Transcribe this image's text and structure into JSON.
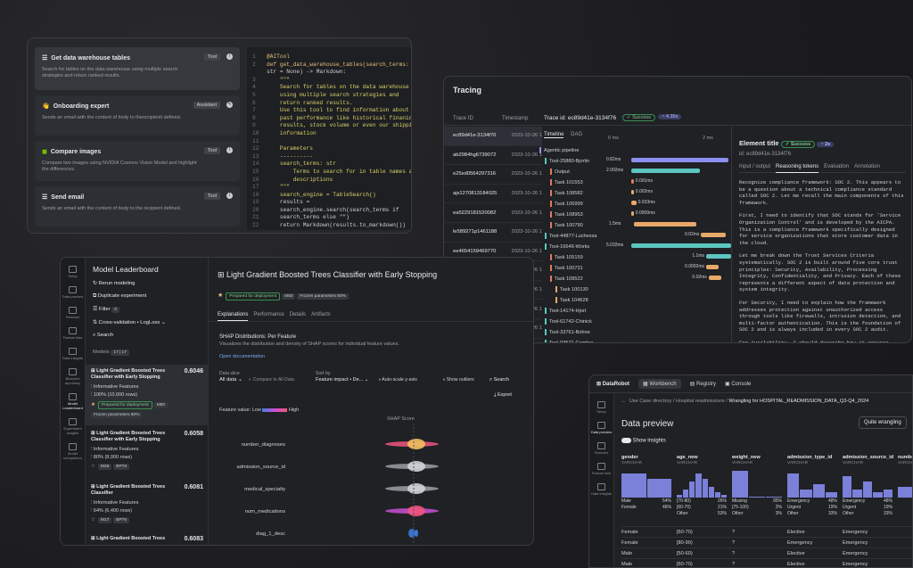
{
  "tools": {
    "items": [
      {
        "title": "Get data warehouse tables",
        "tag": "Tool",
        "desc": "Search for tables on the data warehouse using multiple search strategies and return ranked results."
      },
      {
        "title": "Onboarding expert",
        "tag": "Assistant",
        "desc": "Sends an email with the content of body to therecipientt defined."
      },
      {
        "title": "Compare images",
        "tag": "Tool",
        "desc": "Compare two images using NVIDIA Cosmos Vision Model and highlight the differences."
      },
      {
        "title": "Send email",
        "tag": "Tool",
        "desc": "Sends an email with the content of body to the recipient defined."
      }
    ],
    "code": [
      "@AITool",
      "def get_data_warehouse_tables(search_terms:",
      "str = None) -> Markdown:",
      "    \"\"\"",
      "    Search for tables on the data warehouse",
      "    using multiple search strategies and",
      "    return ranked results.",
      "    Use this tool to find information about",
      "    past performance like historical finanical",
      "    results, stock volume or even our shipping",
      "    information",
      "",
      "    Parameters",
      "    ----------",
      "    search_terms: str",
      "        Terms to search for in table names and",
      "        descriptions",
      "    \"\"\"",
      "    search_engine = TableSearch()",
      "    results =",
      "    search_engine.search(search_terms if",
      "    search_terms else \"\")",
      "    return Markdown(results.to_markdown())"
    ],
    "line_numbers": [
      "1",
      "2",
      "",
      "3",
      "4",
      "5",
      "6",
      "7",
      "8",
      "9",
      "10",
      "11",
      "12",
      "13",
      "14",
      "15",
      "16",
      "17",
      "18",
      "19",
      "20",
      "21",
      "22"
    ]
  },
  "tracing": {
    "title": "Tracing",
    "col_trace_id": "Trace ID",
    "col_timestamp": "Timestamp",
    "trace_header": "Trace id: ec89d41e-3134f76",
    "status": "Success",
    "duration": "4.35s",
    "tab_timeline": "Timeline",
    "tab_dag": "DAG",
    "time_0": "0 ms",
    "time_2": "2 ms",
    "rows": [
      {
        "id": "ec89d41e-3134f76",
        "ts": "2023-10-26 1"
      },
      {
        "id": "ab2984hg6739072",
        "ts": "2023-10-26 1"
      },
      {
        "id": "e25sd0564297316",
        "ts": "2023-10-26 1"
      },
      {
        "id": "ajs1270813184025",
        "ts": "2023-10-26 1"
      },
      {
        "id": "ea5229181520082",
        "ts": "2023-10-26 1"
      },
      {
        "id": "le589271p1461188",
        "ts": "2023-10-26 1"
      },
      {
        "id": "ee4654159469770",
        "ts": "2023-10-26 1"
      },
      {
        "id": "sd4626583971098",
        "ts": "2023-10-26 1"
      },
      {
        "id": "sa6902076008730",
        "ts": "2023-10-26 1"
      },
      {
        "id": "kd1065203071322",
        "ts": "2023-10-26 1"
      },
      {
        "id": "sd4626583971098",
        "ts": "2023-10-26 1"
      }
    ],
    "tree": [
      "Agentic pipeline",
      "Tool-25880-Bjorlin",
      "Output",
      "Task 101553",
      "Task 108582",
      "Task 106999",
      "Task 108953",
      "Task 100790",
      "Tool-44877-Luchessa",
      "Tool-16646-Works",
      "Task 105159",
      "Task 100731",
      "Task 108522",
      "Task 100130",
      "Task 104628",
      "Tool-14174-Hjort",
      "Tool-61742-Chinick",
      "Tool-33761-Bohne",
      "Tool-93571-Cambre"
    ],
    "bars": [
      {
        "label": "0.82ms",
        "start": 0.2,
        "width": 0.78,
        "color": "#8c8ff0"
      },
      {
        "label": "2.002ms",
        "start": 0.2,
        "width": 0.55,
        "color": "#5cc5c0"
      },
      {
        "label": "0.001ms",
        "start": 0.2,
        "width": 0.02,
        "color": "#e07a5a"
      },
      {
        "label": "0.002ms",
        "start": 0.2,
        "width": 0.02,
        "color": "#e8a86a"
      },
      {
        "label": "0.033ms",
        "start": 0.2,
        "width": 0.04,
        "color": "#e8a86a"
      },
      {
        "label": "0.0009ms",
        "start": 0.2,
        "width": 0.02,
        "color": "#e8a86a"
      },
      {
        "label": "1.5ms",
        "start": 0.22,
        "width": 0.5,
        "color": "#e8a86a"
      },
      {
        "label": "0.02ms",
        "start": 0.76,
        "width": 0.2,
        "color": "#e8a86a"
      },
      {
        "label": "5.032ms",
        "start": 0.2,
        "width": 0.8,
        "color": "#5cc5c0"
      },
      {
        "label": "1.1ms",
        "start": 0.8,
        "width": 0.2,
        "color": "#5cc5c0"
      },
      {
        "label": "0.0002ms",
        "start": 0.8,
        "width": 0.1,
        "color": "#e8a86a"
      },
      {
        "label": "0.02ms",
        "start": 0.82,
        "width": 0.1,
        "color": "#e8a86a"
      }
    ],
    "detail": {
      "title": "Element title",
      "status": "Success",
      "time": "2s",
      "id": "id: ec89d41e-3134f76",
      "tabs": [
        "Input / output",
        "Reasoning tokens",
        "Evaluation",
        "Annotation"
      ],
      "text": [
        "Recognize compliance framework: SOC 2. This appears to be a question about a technical compliance standard called SOC 2. Let me recall the main components of this framework.",
        "First, I need to identify that SOC stands for 'Service Organization Control' and is developed by the AICPA. This is a compliance framework specifically designed for service organizations that store customer data in the cloud.",
        "Let me break down the Trust Services Criteria systematically. SOC 2 is built around five core trust principles: Security, Availability, Processing Integrity, Confidentiality, and Privacy. Each of these represents a different aspect of data protection and system integrity.",
        "For Security, I need to explain how the framework addresses protection against unauthorized access through tools like firewalls, intrusion detection, and multi-factor authentication. This is the foundation of SOC 2 and is always included in every SOC 2 audit.",
        "For Availability, I should describe how it ensures"
      ]
    }
  },
  "leader": {
    "rail": [
      "Setup",
      "Data preview",
      "Features",
      "Feature lists",
      "Data insights",
      "Blueprint repository",
      "Model Leaderboard",
      "Experiment insights",
      "Model comparison"
    ],
    "title": "Model Leaderboard",
    "actions": [
      "Rerun modeling",
      "Duplicate experiment"
    ],
    "filter": "Filter",
    "filter_count": "0",
    "cv": "Cross-validation",
    "metric": "LogLoss",
    "search": "Search",
    "models_label": "Models",
    "models_count": "17 | 17",
    "models": [
      {
        "name": "Light Gradient Boosted Trees Classifier with Early Stopping",
        "score": "0.6046",
        "feat": "Informative Features",
        "rows": "100% (10,000 rows)",
        "tags": [
          "Prepared for deployment",
          "M50",
          "Frozen parameters 80%"
        ]
      },
      {
        "name": "Light Gradient Boosted Trees Classifier with Early Stopping",
        "score": "0.6058",
        "feat": "Informative Features",
        "rows": "80% (8,000 rows)",
        "tags": [
          "M48",
          "BP76"
        ]
      },
      {
        "name": "Light Gradient Boosted Trees Classifier",
        "score": "0.6081",
        "feat": "Informative Features",
        "rows": "64% (6,400 rows)",
        "tags": [
          "M17",
          "BP76"
        ]
      },
      {
        "name": "Light Gradient Boosted Trees",
        "score": "0.6083",
        "feat": "",
        "rows": "",
        "tags": []
      }
    ],
    "main_title": "Light Gradient Boosted Trees Classifier with Early Stopping",
    "main_tags": [
      "Prepared for deployment",
      "M50",
      "Frozen parameters 80%"
    ],
    "tabs": [
      "Explanations",
      "Performance",
      "Details",
      "Artifacts"
    ],
    "shap_title": "SHAP Distributions: Per Feature",
    "shap_desc": "Visualizes the distribution and density of SHAP scores for individual feature values.",
    "open_doc": "Open documentation",
    "data_slice_label": "Data slice",
    "data_slice": "All data",
    "compare": "Compare to All Data",
    "sort_label": "Sort by",
    "sort": "Feature impact • De...",
    "autoscale": "Auto-scale y-axis",
    "outliers": "Show outliers",
    "search2": "Search",
    "export": "Export",
    "fv_label": "Feature value:",
    "low": "Low",
    "high": "High",
    "shap_score": "SHAP Score",
    "features": [
      "number_diagnoses",
      "admission_source_id",
      "medical_specialty",
      "num_medications",
      "diag_1_desc"
    ]
  },
  "dr": {
    "brand": "DataRobot",
    "nav": [
      "Workbench",
      "Registry",
      "Console"
    ],
    "rail": [
      "Setup",
      "Data preview",
      "Features",
      "Feature lists",
      "Data insights"
    ],
    "crumb": "Use Case directory / Hospital readmissions",
    "crumb_bold": "Wrangling for HOSPITAL_READMISSION_DATA_Q3-Q4_2024",
    "title": "Data preview",
    "show_insights": "Show insights",
    "quit": "Quite wrangling",
    "cols": [
      {
        "name": "gender",
        "type": "VARCHAR",
        "stats": [
          [
            "Male",
            "54%"
          ],
          [
            "Female",
            "46%"
          ]
        ]
      },
      {
        "name": "age_new",
        "type": "VARCHAR",
        "stats": [
          [
            "[70-80)",
            "26%"
          ],
          [
            "[60-70)",
            "21%"
          ],
          [
            "Other",
            "53%"
          ]
        ]
      },
      {
        "name": "weight_new",
        "type": "VARCHAR",
        "stats": [
          [
            "Missing",
            "95%"
          ],
          [
            "[75-100)",
            "2%"
          ],
          [
            "Other",
            "3%"
          ]
        ]
      },
      {
        "name": "admission_type_id",
        "type": "VARCHAR",
        "stats": [
          [
            "Emergency",
            "48%"
          ],
          [
            "Urgent",
            "19%"
          ],
          [
            "Other",
            "33%"
          ]
        ]
      },
      {
        "name": "admission_source_id",
        "type": "VARCHAR",
        "stats": [
          [
            "Emergency",
            "48%"
          ],
          [
            "Urgent",
            "19%"
          ],
          [
            "Other",
            "33%"
          ]
        ]
      },
      {
        "name": "numbe",
        "type": "VARCH",
        "stats": []
      }
    ],
    "rows": [
      [
        "Female",
        "[60-70)",
        "?",
        "Elective",
        "Emergency"
      ],
      [
        "Female",
        "[80-90)",
        "?",
        "Emergency",
        "Emergency"
      ],
      [
        "Male",
        "[50-60)",
        "?",
        "Elective",
        "Emergency"
      ],
      [
        "Male",
        "[60-70)",
        "?",
        "Elective",
        "Emergency"
      ]
    ]
  }
}
